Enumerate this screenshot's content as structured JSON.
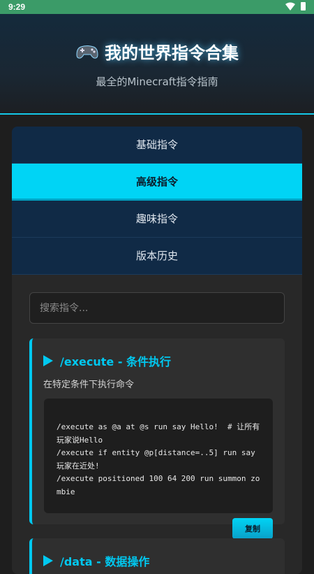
{
  "status": {
    "time": "9:29"
  },
  "header": {
    "title": "我的世界指令合集",
    "subtitle": "最全的Minecraft指令指南",
    "icon": "gamepad-icon"
  },
  "tabs": [
    {
      "label": "基础指令",
      "active": false
    },
    {
      "label": "高级指令",
      "active": true
    },
    {
      "label": "趣味指令",
      "active": false
    },
    {
      "label": "版本历史",
      "active": false
    }
  ],
  "search": {
    "placeholder": "搜索指令..."
  },
  "commands": [
    {
      "title": "/execute - 条件执行",
      "description": "在特定条件下执行命令",
      "code": "/execute as @a at @s run say Hello!  # 让所有玩家说Hello\n/execute if entity @p[distance=..5] run say 玩家在近处!\n/execute positioned 100 64 200 run summon zombie",
      "copy_label": "复制"
    },
    {
      "title": "/data - 数据操作"
    }
  ],
  "colors": {
    "accent": "#00d4f5",
    "tab_bg": "#102a46",
    "statusbar": "#3b9b68"
  }
}
